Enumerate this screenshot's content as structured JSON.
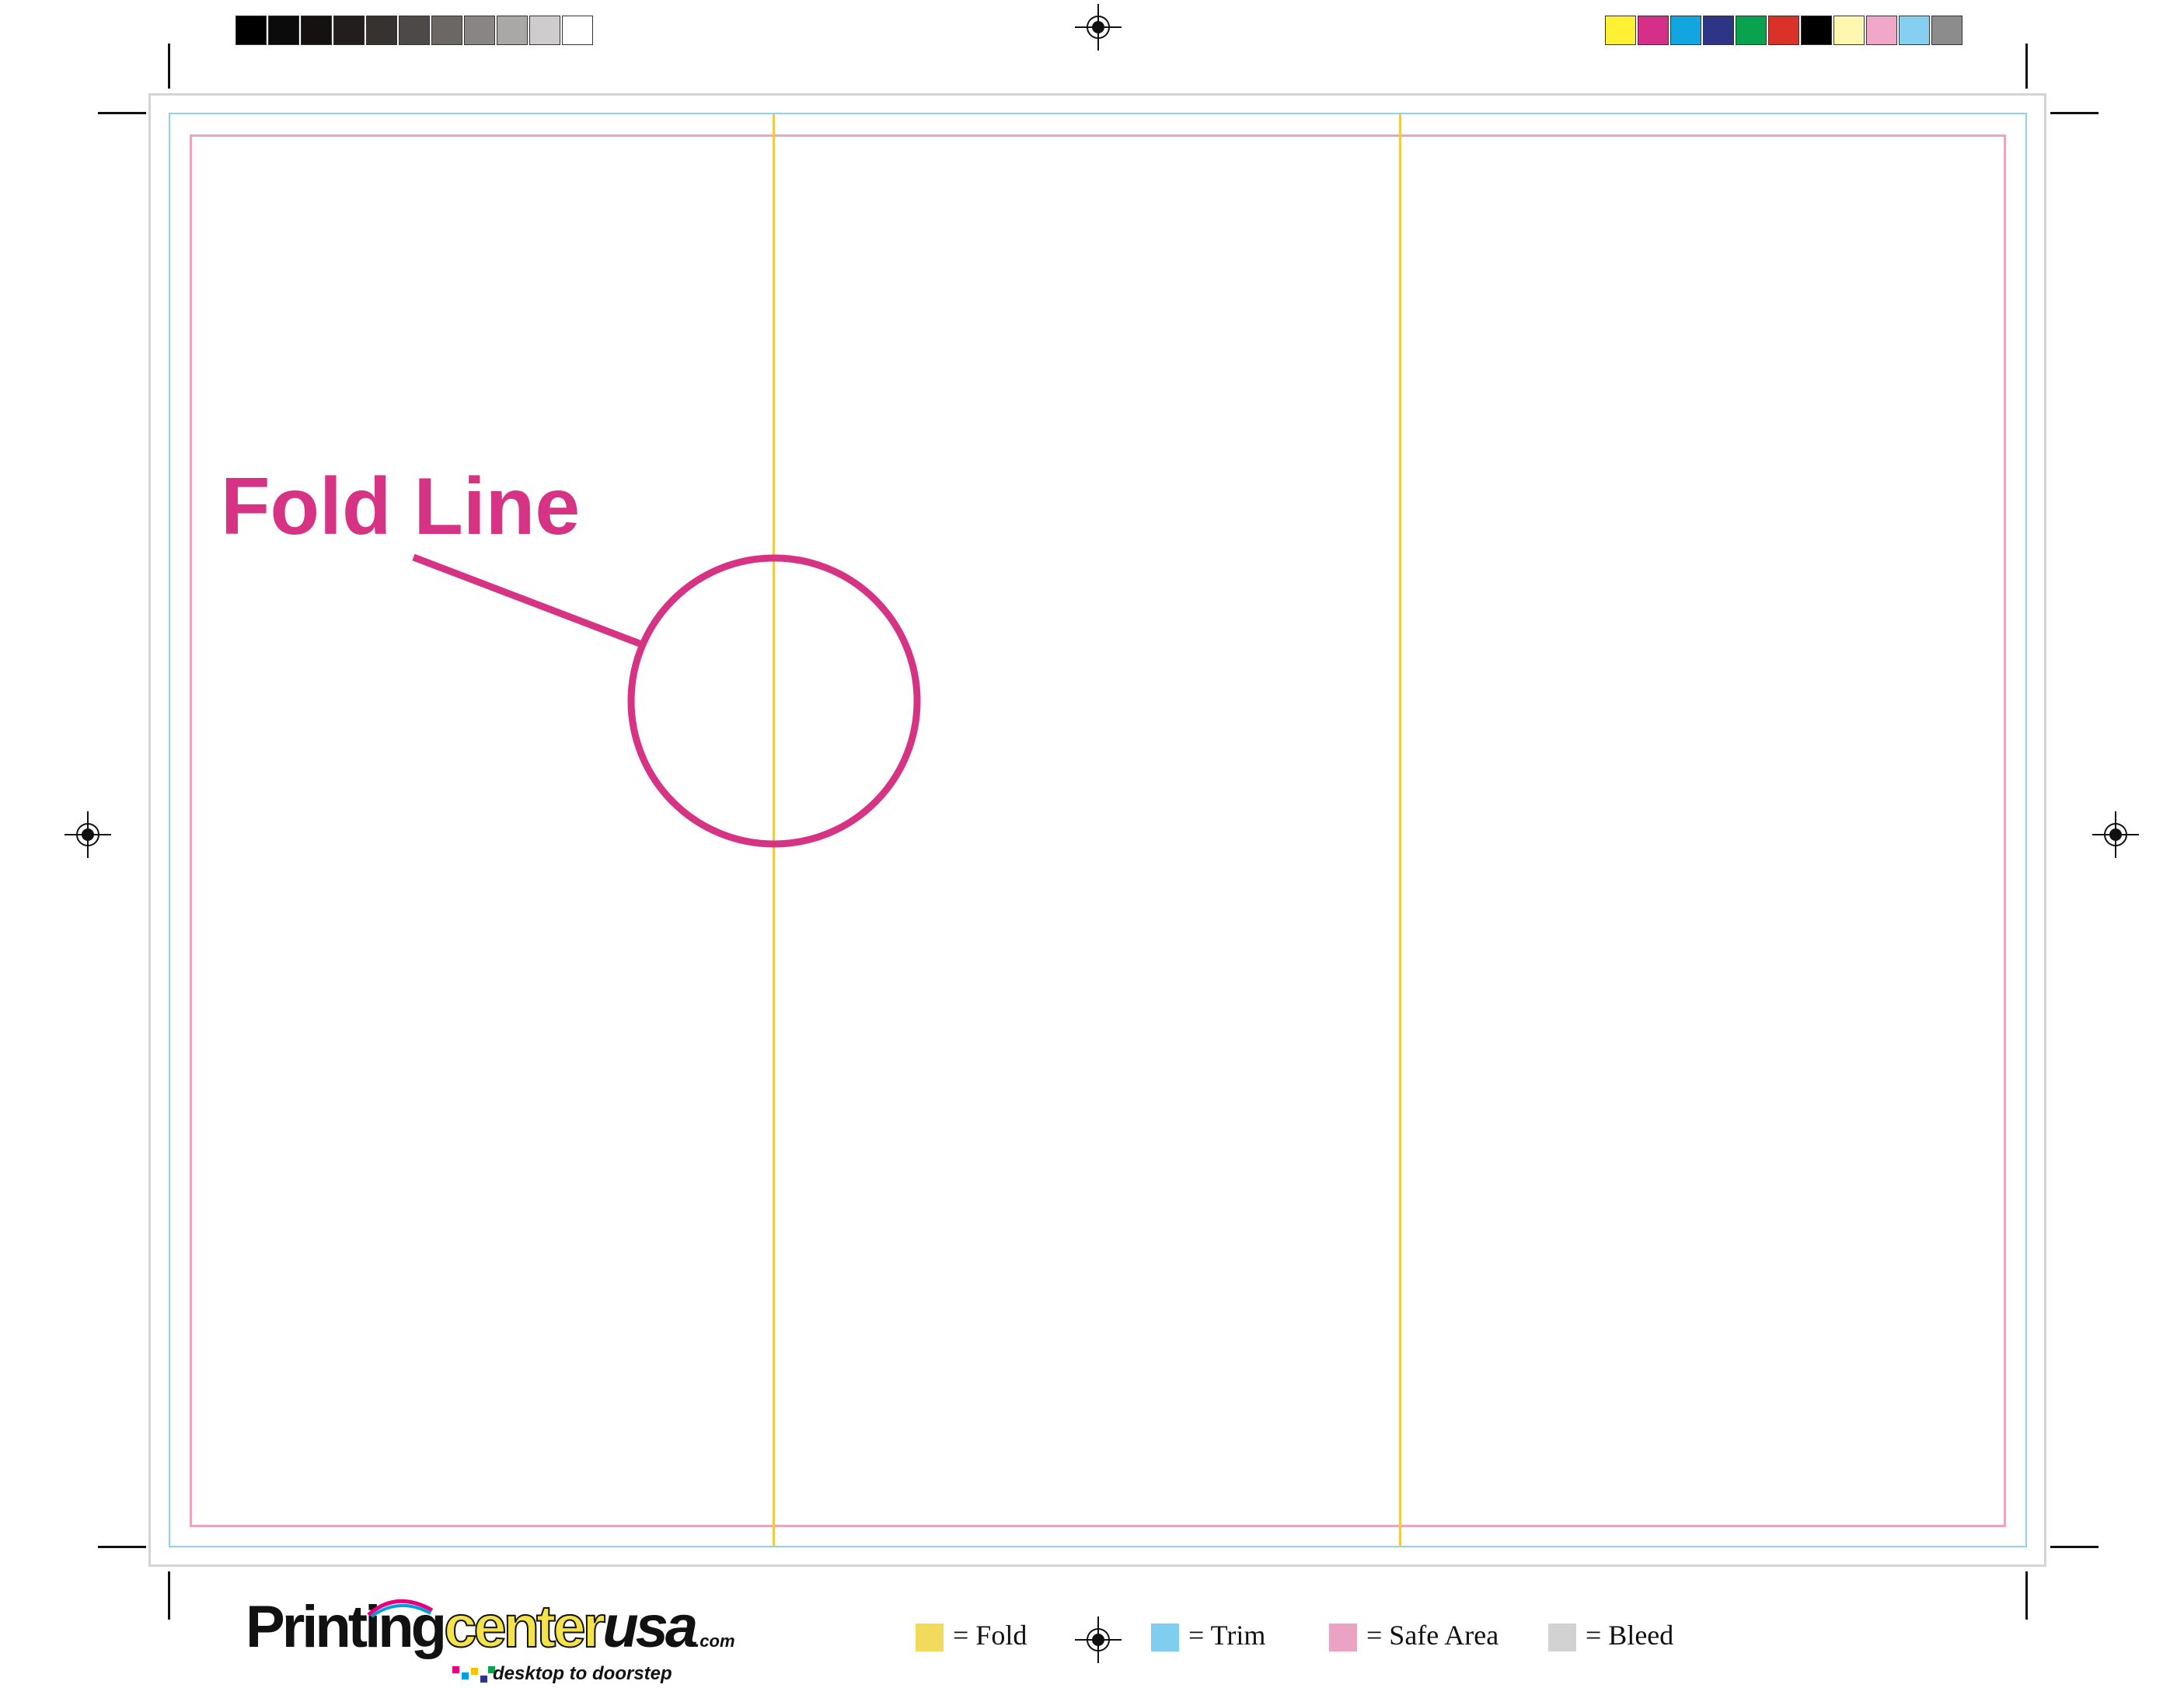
{
  "callout": {
    "label": "Fold Line",
    "color": "#d63384"
  },
  "legend": {
    "items": [
      {
        "label": "= Fold",
        "color": "#f2da5c"
      },
      {
        "label": "= Trim",
        "color": "#7fcdef"
      },
      {
        "label": "=  Safe Area",
        "color": "#eaa3c3"
      },
      {
        "label": "= Bleed",
        "color": "#d2d2d2"
      }
    ]
  },
  "logo": {
    "part_printing": "Printing",
    "part_center": "center",
    "part_usa": "usa",
    "part_com": ".com",
    "tagline": "desktop to doorstep"
  },
  "color_bars": {
    "grayscale": [
      "#000000",
      "#0b0b0b",
      "#151111",
      "#221e1d",
      "#363230",
      "#4d4947",
      "#6a6765",
      "#888584",
      "#aaa8a7",
      "#cecccc",
      "#ffffff"
    ],
    "process": [
      "#fff033",
      "#d62f8a",
      "#12a6e0",
      "#2e3486",
      "#0aa24e",
      "#da3229",
      "#000000",
      "#fff6b0",
      "#f0a7c8",
      "#86cff0",
      "#8c8c8c"
    ]
  },
  "guide_colors": {
    "bleed": "#d4d4d4",
    "trim": "#8fd3e8",
    "safe": "#efa3c3",
    "fold": "#f6c84a"
  }
}
